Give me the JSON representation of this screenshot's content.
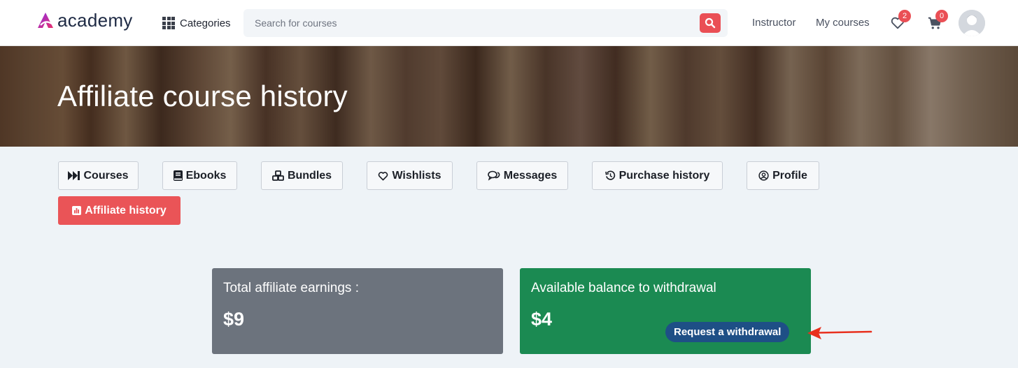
{
  "header": {
    "logo_text": "academy",
    "categories_label": "Categories",
    "search_placeholder": "Search for courses",
    "nav": {
      "instructor": "Instructor",
      "my_courses": "My courses"
    },
    "wishlist_count": "2",
    "cart_count": "0"
  },
  "banner": {
    "title": "Affiliate course history"
  },
  "tabs": [
    {
      "label": "Courses",
      "icon": "forward-step-icon"
    },
    {
      "label": "Ebooks",
      "icon": "book-icon"
    },
    {
      "label": "Bundles",
      "icon": "cubes-icon"
    },
    {
      "label": "Wishlists",
      "icon": "heart-icon"
    },
    {
      "label": "Messages",
      "icon": "comments-icon"
    },
    {
      "label": "Purchase history",
      "icon": "history-icon"
    },
    {
      "label": "Profile",
      "icon": "user-circle-icon"
    },
    {
      "label": "Affiliate history",
      "icon": "chart-bar-icon",
      "active": true
    }
  ],
  "cards": {
    "total_earnings": {
      "title": "Total affiliate earnings :",
      "amount": "$9"
    },
    "available_balance": {
      "title": "Available balance to withdrawal",
      "amount": "$4",
      "button_label": "Request a withdrawal"
    }
  },
  "colors": {
    "accent": "#ea5457",
    "earnings_card": "#6c737d",
    "balance_card": "#1b8a52",
    "withdraw_button": "#1e4f86",
    "annotation_arrow": "#e8301e"
  }
}
